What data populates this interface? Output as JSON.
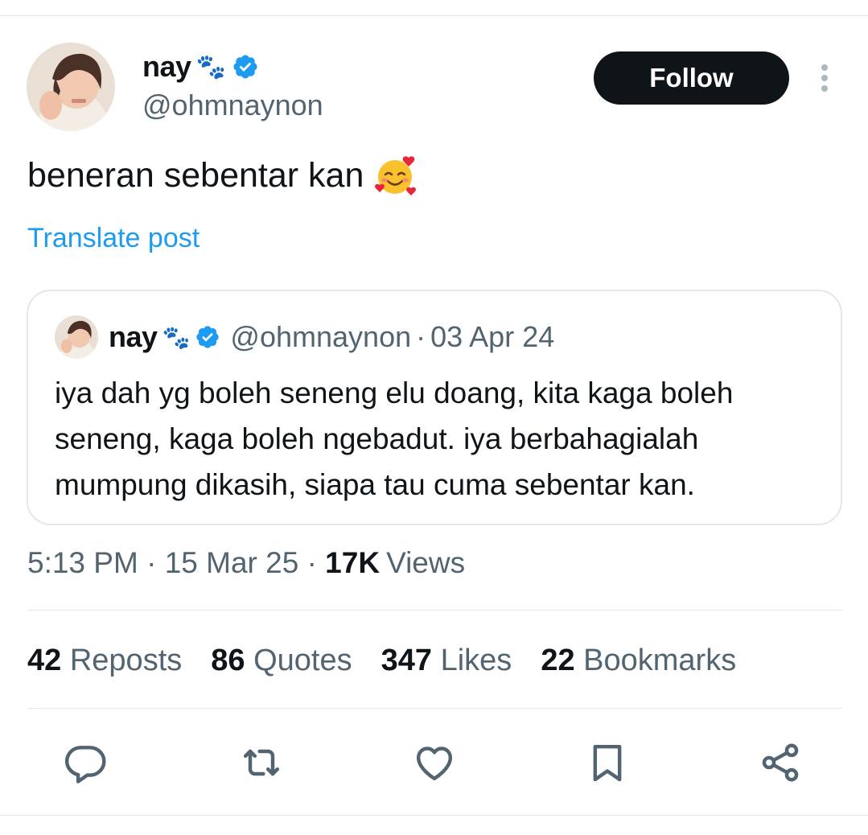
{
  "author": {
    "display_name": "nay",
    "name_emoji": "🐾",
    "handle": "@ohmnaynon",
    "verified": true
  },
  "header": {
    "follow_label": "Follow"
  },
  "post": {
    "text": "beneran sebentar kan",
    "emoji": "🥰",
    "translate_label": "Translate post"
  },
  "quote": {
    "display_name": "nay",
    "name_emoji": "🐾",
    "handle": "@ohmnaynon",
    "separator": "·",
    "date": "03 Apr 24",
    "text": "iya dah yg boleh seneng elu doang, kita kaga boleh seneng, kaga boleh ngebadut. iya berbahagialah mumpung dikasih, siapa tau cuma sebentar kan."
  },
  "meta": {
    "time": "5:13 PM",
    "separator": "·",
    "date": "15 Mar 25",
    "views_count": "17K",
    "views_label": "Views"
  },
  "stats": [
    {
      "count": "42",
      "label": "Reposts"
    },
    {
      "count": "86",
      "label": "Quotes"
    },
    {
      "count": "347",
      "label": "Likes"
    },
    {
      "count": "22",
      "label": "Bookmarks"
    }
  ],
  "colors": {
    "accent": "#1d9bf0",
    "text_primary": "#0f1419",
    "text_secondary": "#536471",
    "border": "#e1e8ed",
    "button_bg": "#0f1419",
    "verified_badge": "#1d9bf0"
  },
  "icons": {
    "reply": "reply-icon",
    "repost": "repost-icon",
    "like": "heart-icon",
    "bookmark": "bookmark-icon",
    "share": "share-icon",
    "more": "more-icon",
    "verified": "verified-badge-icon"
  }
}
